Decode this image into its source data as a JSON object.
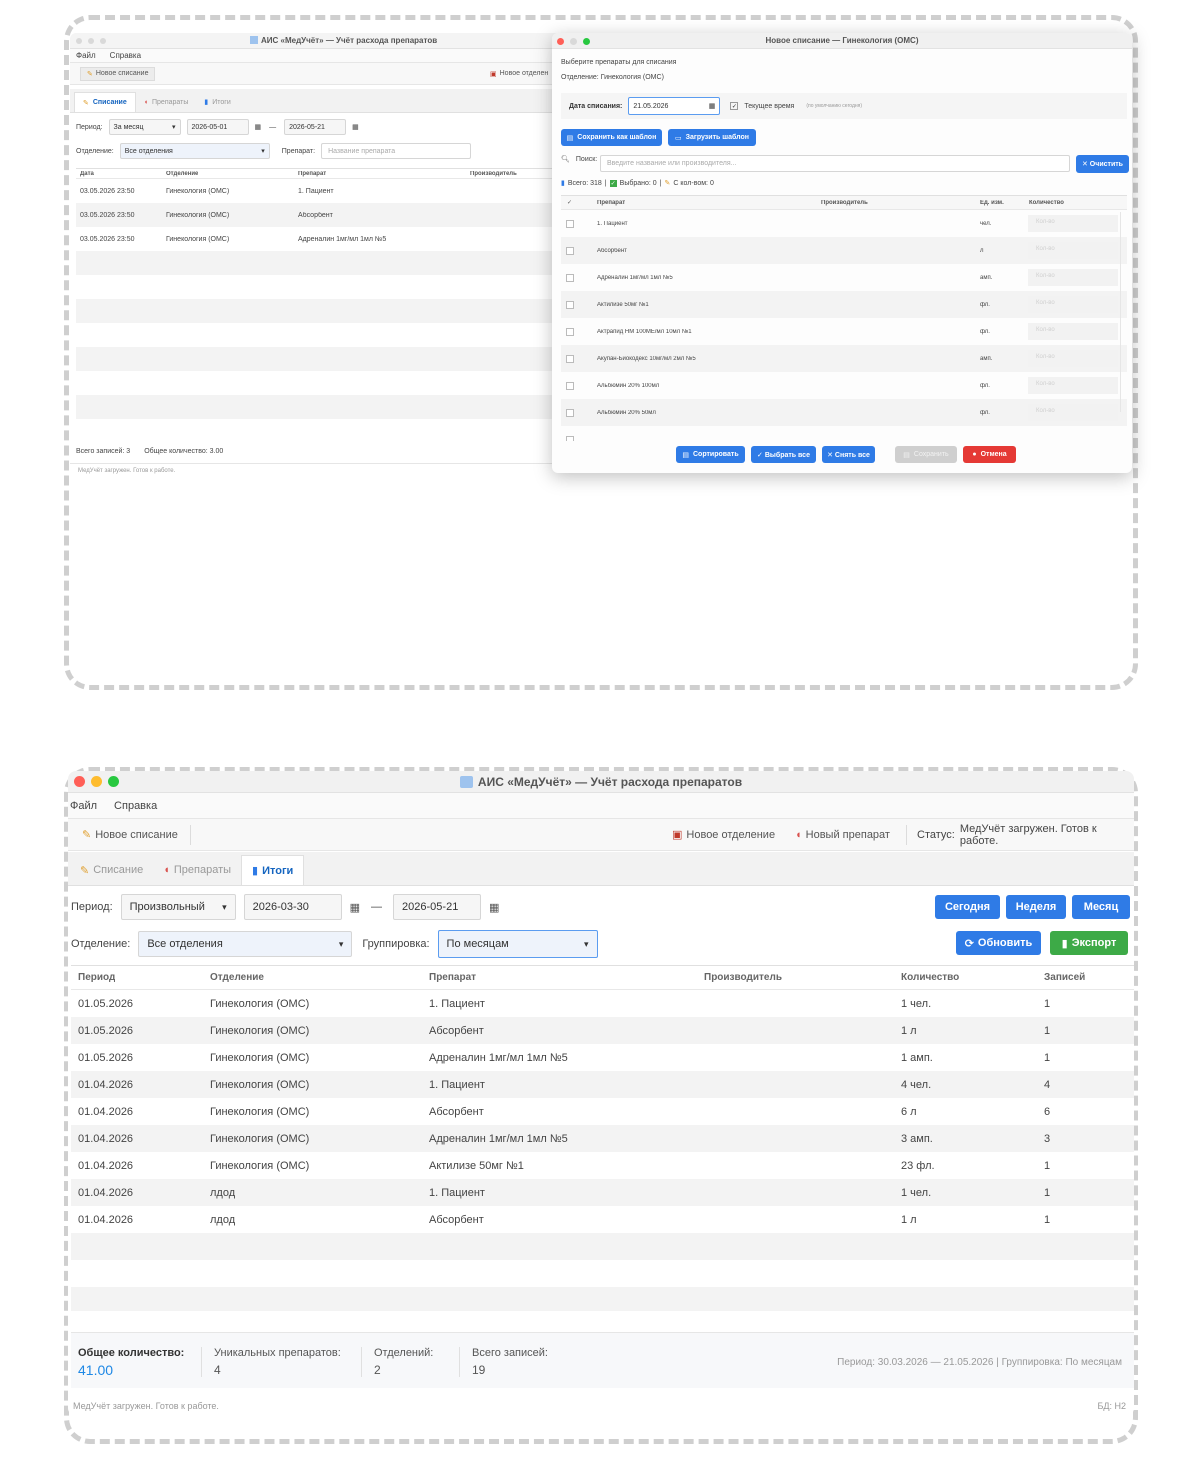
{
  "colors": {
    "accent": "#2f7be6",
    "green": "#3daa47",
    "red": "#e53935",
    "tab_active": "#1565c0",
    "total_value": "#1e88e5"
  },
  "top_main": {
    "title": "АИС «МедУчёт» — Учёт расхода препаратов",
    "menu": [
      "Файл",
      "Справка"
    ],
    "toolbar": {
      "new_writeoff": "Новое списание",
      "new_department": "Новое отделен"
    },
    "tabs": [
      {
        "label": "Списание",
        "icon": "pencil-icon"
      },
      {
        "label": "Препараты",
        "icon": "pill-icon"
      },
      {
        "label": "Итоги",
        "icon": "chart-icon"
      }
    ],
    "filters": {
      "period_label": "Период:",
      "period_value": "За месяц",
      "date_from": "2026-05-01",
      "date_to": "2026-05-21",
      "dash": "—",
      "department_label": "Отделение:",
      "department_value": "Все отделения",
      "drug_label": "Препарат:",
      "drug_placeholder": "Название препарата"
    },
    "table": {
      "headers": [
        "Дата",
        "Отделение",
        "Препарат",
        "Производитель"
      ],
      "rows": [
        [
          "03.05.2026 23:50",
          "Гинекология (ОМС)",
          "1. Пациент",
          ""
        ],
        [
          "03.05.2026 23:50",
          "Гинекология (ОМС)",
          "Абсорбент",
          ""
        ],
        [
          "03.05.2026 23:50",
          "Гинекология (ОМС)",
          "Адреналин 1мг/мл 1мл №5",
          ""
        ]
      ]
    },
    "footer": {
      "total_records": "Всего записей: 3",
      "total_qty": "Общее количество: 3.00"
    },
    "status": "МедУчёт загружен. Готов к работе."
  },
  "dialog": {
    "title": "Новое списание — Гинекология (ОМС)",
    "subtitle": "Выберите препараты для списания",
    "department": "Отделение: Гинекология (ОМС)",
    "date_label": "Дата списания:",
    "date_value": "21.05.2026",
    "current_time_label": "Текущее время",
    "current_time_hint": "(по умолчанию сегодня)",
    "save_template": "Сохранить как шаблон",
    "load_template": "Загрузить шаблон",
    "search_label": "Поиск:",
    "search_placeholder": "Введите название или производителя...",
    "clear_button": "✕ Очистить",
    "stats_total": "Всего: 318",
    "stats_selected": "Выбрано: 0",
    "stats_with_qty": "С кол-вом: 0",
    "table": {
      "headers": [
        "✓",
        "Препарат",
        "Производитель",
        "Ед. изм.",
        "Количество"
      ],
      "qty_placeholder": "Кол-во",
      "rows": [
        [
          "1. Пациент",
          "",
          "чел."
        ],
        [
          "Абсорбент",
          "",
          "л"
        ],
        [
          "Адреналин 1мг/мл 1мл №5",
          "",
          "амп."
        ],
        [
          "Актилизе 50мг №1",
          "",
          "фл."
        ],
        [
          "Актрапид НМ 100МЕ/мл 10мл №1",
          "",
          "фл."
        ],
        [
          "Акупан-Биокодекс 10мг/мл 2мл №5",
          "",
          "амп."
        ],
        [
          "Альбюмин 20% 100мл",
          "",
          "фл."
        ],
        [
          "Альбюмин 20% 50мл",
          "",
          "фл."
        ]
      ]
    },
    "buttons": {
      "sort": "Сортировать",
      "select_all": "✓ Выбрать все",
      "deselect_all": "✕ Снять все",
      "save": "Сохранить",
      "cancel": "Отмена"
    }
  },
  "bottom": {
    "title": "АИС «МедУчёт» — Учёт расхода препаратов",
    "menu": [
      "Файл",
      "Справка"
    ],
    "toolbar": {
      "new_writeoff": "Новое списание",
      "new_department": "Новое отделение",
      "new_drug": "Новый препарат",
      "status_label": "Статус:",
      "status_value": "МедУчёт загружен. Готов к работе."
    },
    "tabs": [
      {
        "label": "Списание",
        "icon": "pencil-icon"
      },
      {
        "label": "Препараты",
        "icon": "pill-icon"
      },
      {
        "label": "Итоги",
        "icon": "chart-icon"
      }
    ],
    "filters": {
      "period_label": "Период:",
      "period_value": "Произвольный",
      "date_from": "2026-03-30",
      "date_to": "2026-05-21",
      "dash": "—",
      "today": "Сегодня",
      "week": "Неделя",
      "month": "Месяц",
      "department_label": "Отделение:",
      "department_value": "Все отделения",
      "grouping_label": "Группировка:",
      "grouping_value": "По месяцам",
      "refresh": "Обновить",
      "export": "Экспорт"
    },
    "table": {
      "headers": [
        "Период",
        "Отделение",
        "Препарат",
        "Производитель",
        "Количество",
        "Записей"
      ],
      "rows": [
        [
          "01.05.2026",
          "Гинекология (ОМС)",
          "1. Пациент",
          "",
          "1 чел.",
          "1"
        ],
        [
          "01.05.2026",
          "Гинекология (ОМС)",
          "Абсорбент",
          "",
          "1 л",
          "1"
        ],
        [
          "01.05.2026",
          "Гинекология (ОМС)",
          "Адреналин 1мг/мл 1мл №5",
          "",
          "1 амп.",
          "1"
        ],
        [
          "01.04.2026",
          "Гинекология (ОМС)",
          "1. Пациент",
          "",
          "4 чел.",
          "4"
        ],
        [
          "01.04.2026",
          "Гинекология (ОМС)",
          "Абсорбент",
          "",
          "6 л",
          "6"
        ],
        [
          "01.04.2026",
          "Гинекология (ОМС)",
          "Адреналин 1мг/мл 1мл №5",
          "",
          "3 амп.",
          "3"
        ],
        [
          "01.04.2026",
          "Гинекология (ОМС)",
          "Актилизе 50мг №1",
          "",
          "23 фл.",
          "1"
        ],
        [
          "01.04.2026",
          "лдод",
          "1. Пациент",
          "",
          "1 чел.",
          "1"
        ],
        [
          "01.04.2026",
          "лдод",
          "Абсорбент",
          "",
          "1 л",
          "1"
        ]
      ]
    },
    "summary": {
      "total_qty_label": "Общее количество:",
      "total_qty_value": "41.00",
      "unique_label": "Уникальных препаратов:",
      "unique_value": "4",
      "departments_label": "Отделений:",
      "departments_value": "2",
      "records_label": "Всего записей:",
      "records_value": "19",
      "period_info": "Период: 30.03.2026 — 21.05.2026 | Группировка: По месяцам"
    },
    "status": "МедУчёт загружен. Готов к работе.",
    "db": "БД: H2"
  }
}
